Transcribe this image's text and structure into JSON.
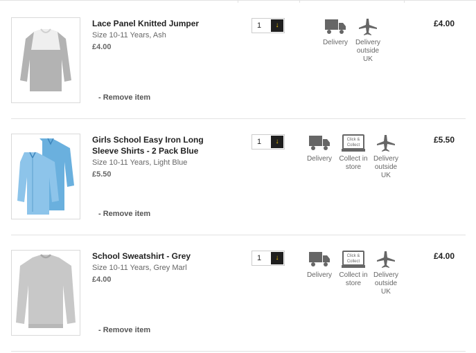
{
  "items": [
    {
      "name": "Lace Panel Knitted Jumper",
      "size": "Size 10-11 Years, Ash",
      "unit_price": "£4.00",
      "remove_label": "- Remove item",
      "quantity": "1",
      "quantity_button": "↓",
      "options": [
        "Delivery",
        "Delivery outside UK"
      ],
      "price": "£4.00"
    },
    {
      "name": "Girls School Easy Iron Long Sleeve Shirts - 2 Pack Blue",
      "size": "Size 10-11 Years, Light Blue",
      "unit_price": "£5.50",
      "remove_label": "- Remove item",
      "quantity": "1",
      "quantity_button": "↓",
      "options": [
        "Delivery",
        "Collect in store",
        "Delivery outside UK"
      ],
      "price": "£5.50"
    },
    {
      "name": "School Sweatshirt - Grey",
      "size": "Size 10-11 Years, Grey Marl",
      "unit_price": "£4.00",
      "remove_label": "- Remove item",
      "quantity": "1",
      "quantity_button": "↓",
      "options": [
        "Delivery",
        "Collect in store",
        "Delivery outside UK"
      ],
      "price": "£4.00"
    }
  ],
  "click_collect_badge": [
    "Click &",
    "Collect"
  ],
  "colors": {
    "qty_button_bg": "#1f1f1f",
    "qty_arrow": "#f5c800",
    "icon_grey": "#666666"
  }
}
